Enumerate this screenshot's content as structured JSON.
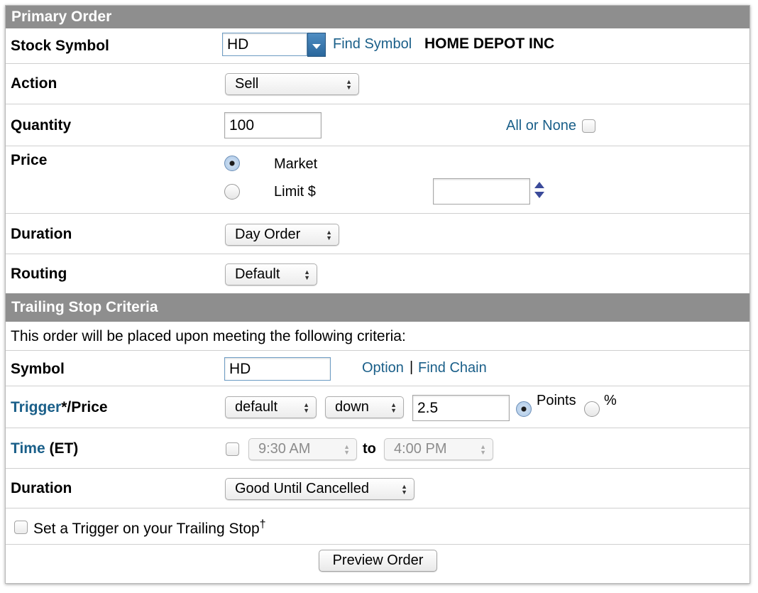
{
  "primary": {
    "header": "Primary Order",
    "stock_symbol": {
      "label": "Stock Symbol",
      "value": "HD",
      "find_symbol": "Find Symbol",
      "company": "HOME DEPOT INC"
    },
    "action": {
      "label": "Action",
      "value": "Sell"
    },
    "quantity": {
      "label": "Quantity",
      "value": "100",
      "all_or_none": "All or None"
    },
    "price": {
      "label": "Price",
      "market": "Market",
      "limit": "Limit $",
      "selected": "Market",
      "limit_value": ""
    },
    "duration": {
      "label": "Duration",
      "value": "Day Order"
    },
    "routing": {
      "label": "Routing",
      "value": "Default"
    }
  },
  "trailing": {
    "header": "Trailing Stop Criteria",
    "intro": "This order will be placed upon meeting the following criteria:",
    "symbol": {
      "label": "Symbol",
      "value": "HD",
      "option": "Option",
      "sep": "|",
      "find_chain": "Find Chain"
    },
    "trigger": {
      "label_link": "Trigger",
      "label_rest": "*/Price",
      "type": "default",
      "direction": "down",
      "amount": "2.5",
      "points": "Points",
      "percent": "%",
      "selected": "Points"
    },
    "time": {
      "label_link": "Time",
      "label_rest": " (ET)",
      "from": "9:30 AM",
      "to_label": "to",
      "to": "4:00 PM"
    },
    "duration": {
      "label": "Duration",
      "value": "Good Until Cancelled"
    },
    "set_trigger": {
      "label": "Set a Trigger on your Trailing Stop",
      "dagger": "†"
    }
  },
  "preview_button": "Preview Order",
  "colors": {
    "header_bg": "#8e8e8e",
    "link": "#1a5f89",
    "accent": "#3b78b0"
  }
}
